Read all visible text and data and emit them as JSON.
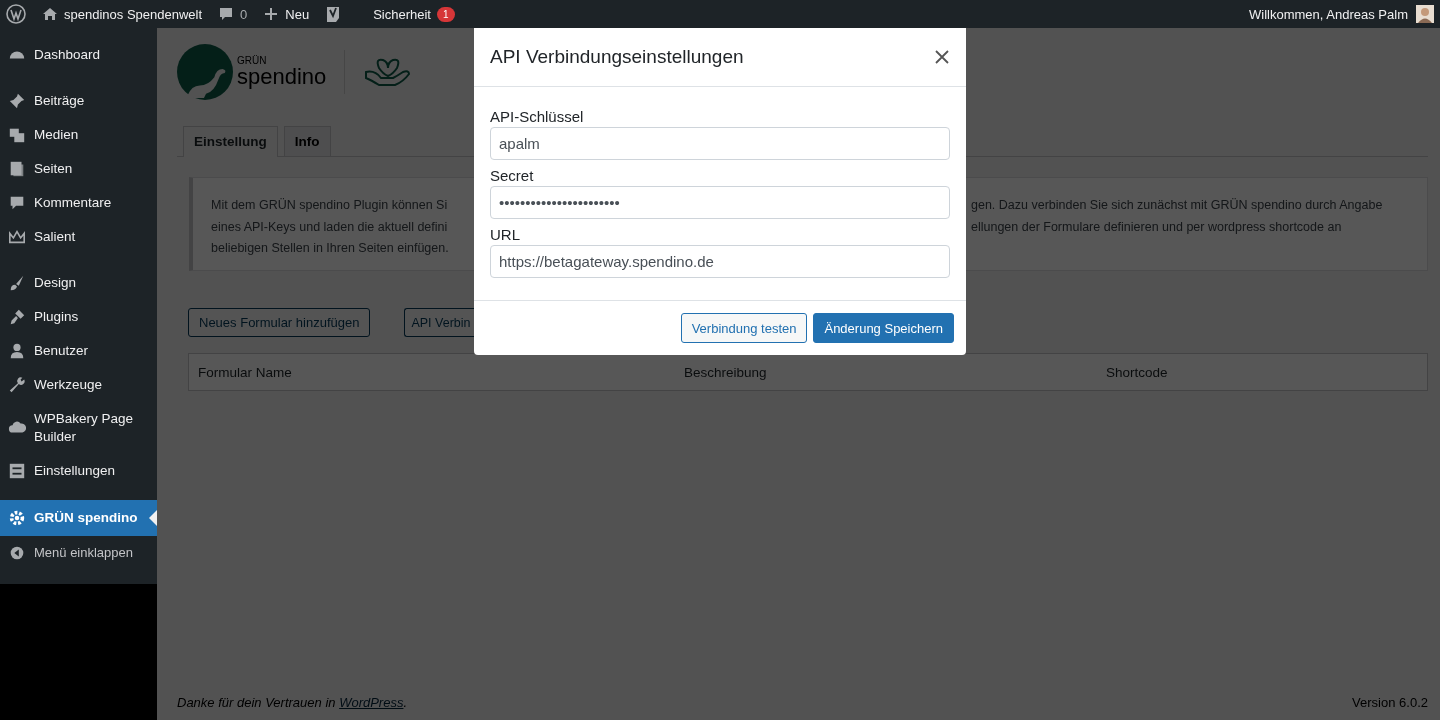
{
  "admin_bar": {
    "site_name": "spendinos Spendenwelt",
    "comments_count": "0",
    "new_label": "Neu",
    "security_label": "Sicherheit",
    "security_badge": "1",
    "greeting": "Willkommen, Andreas Palm"
  },
  "sidebar": {
    "groups": [
      {
        "items": [
          {
            "label": "Dashboard",
            "selected": false
          }
        ]
      },
      {
        "items": [
          {
            "label": "Beiträge",
            "selected": false
          },
          {
            "label": "Medien",
            "selected": false
          },
          {
            "label": "Seiten",
            "selected": false
          },
          {
            "label": "Kommentare",
            "selected": false
          },
          {
            "label": "Salient",
            "selected": false
          }
        ]
      },
      {
        "items": [
          {
            "label": "Design",
            "selected": false
          },
          {
            "label": "Plugins",
            "selected": false
          },
          {
            "label": "Benutzer",
            "selected": false
          },
          {
            "label": "Werkzeuge",
            "selected": false
          },
          {
            "label": "WPBakery Page Builder",
            "selected": false
          },
          {
            "label": "Einstellungen",
            "selected": false
          }
        ]
      },
      {
        "items": [
          {
            "label": "GRÜN spendino",
            "selected": true
          }
        ]
      }
    ],
    "collapse_label": "Menü einklappen"
  },
  "logo": {
    "brand_top": "GRÜN",
    "brand_name": "spendino"
  },
  "tabs": [
    {
      "label": "Einstellung",
      "selected": true
    },
    {
      "label": "Info",
      "selected": false
    }
  ],
  "notice": {
    "left_fragments": [
      "Mit dem GRÜN spendino Plugin können Si",
      "eines API-Keys und laden die aktuell defini",
      "beliebigen Stellen in Ihren Seiten einfügen."
    ],
    "right_fragments": [
      "gen. Dazu verbinden Sie sich zunächst mit GRÜN spendino durch Angabe",
      "ellungen der Formulare definieren und per wordpress shortcode an"
    ]
  },
  "actions": [
    "Neues Formular hinzufügen",
    "API Verbin"
  ],
  "table": {
    "columns": [
      "Formular Name",
      "Beschreibung",
      "Shortcode"
    ]
  },
  "footer": {
    "thanks": "Danke für dein Vertrauen in ",
    "link": "WordPress",
    "after_link": ".",
    "version": "Version 6.0.2"
  },
  "modal": {
    "title": "API Verbindungseinstellungen",
    "fields": [
      {
        "label": "API-Schlüssel",
        "value": "apalm"
      },
      {
        "label": "Secret",
        "value": "•••••••••••••••••••••••"
      },
      {
        "label": "URL",
        "value": "https://betagateway.spendino.de"
      }
    ],
    "buttons": [
      {
        "label": "Verbindung testen",
        "kind": "secondary"
      },
      {
        "label": "Änderung Speichern",
        "kind": "primary"
      }
    ]
  }
}
